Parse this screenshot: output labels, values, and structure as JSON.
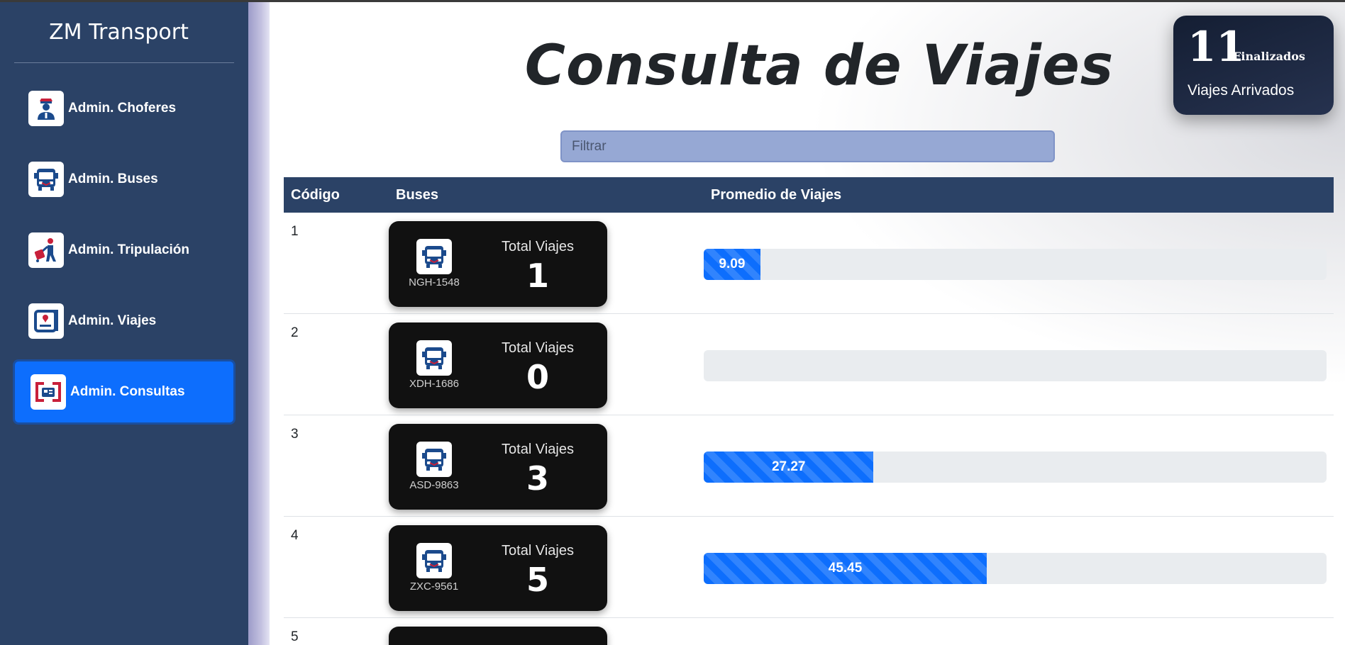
{
  "app": {
    "brand": "ZM Transport"
  },
  "sidebar": {
    "items": [
      {
        "label": "Admin. Choferes",
        "icon": "driver-icon",
        "active": false
      },
      {
        "label": "Admin. Buses",
        "icon": "bus-icon",
        "active": false
      },
      {
        "label": "Admin. Tripulación",
        "icon": "crew-icon",
        "active": false
      },
      {
        "label": "Admin. Viajes",
        "icon": "trips-icon",
        "active": false
      },
      {
        "label": "Admin. Consultas",
        "icon": "queries-icon",
        "active": true
      }
    ]
  },
  "page": {
    "title": "Consulta de Viajes"
  },
  "filter": {
    "placeholder": "Filtrar",
    "value": ""
  },
  "stat": {
    "number": "11",
    "tag": "Finalizados",
    "subtitle": "Viajes Arrivados"
  },
  "table": {
    "headers": {
      "code": "Código",
      "buses": "Buses",
      "average": "Promedio de Viajes"
    },
    "total_label": "Total Viajes",
    "rows": [
      {
        "code": "1",
        "plate": "NGH-1548",
        "total": "1",
        "average": 9.09,
        "average_label": "9.09"
      },
      {
        "code": "2",
        "plate": "XDH-1686",
        "total": "0",
        "average": 0,
        "average_label": ""
      },
      {
        "code": "3",
        "plate": "ASD-9863",
        "total": "3",
        "average": 27.27,
        "average_label": "27.27"
      },
      {
        "code": "4",
        "plate": "ZXC-9561",
        "total": "5",
        "average": 45.45,
        "average_label": "45.45"
      },
      {
        "code": "5"
      }
    ]
  },
  "colors": {
    "sidebar": "#2b4266",
    "accent": "#0d6efd",
    "filter_bg": "#96a8d4",
    "card": "#111111"
  }
}
